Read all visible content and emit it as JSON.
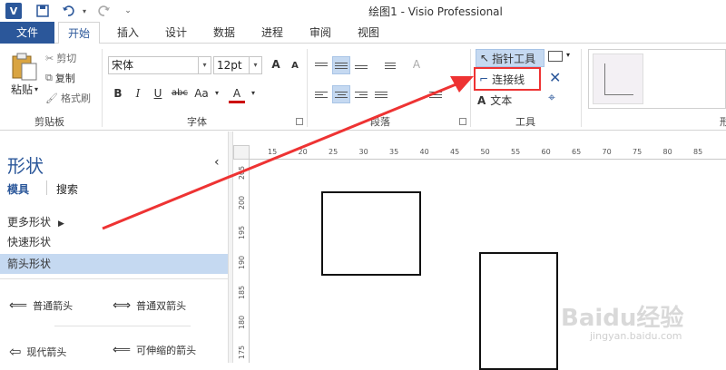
{
  "window": {
    "title": "绘图1 - Visio Professional"
  },
  "qat": {
    "app_icon": "V",
    "save_icon": "save-icon",
    "undo_icon": "undo-icon",
    "redo_icon": "redo-icon"
  },
  "tabs": [
    "文件",
    "开始",
    "插入",
    "设计",
    "数据",
    "进程",
    "审阅",
    "视图"
  ],
  "ribbon": {
    "clipboard": {
      "paste": "粘贴",
      "cut": "剪切",
      "copy": "复制",
      "format_painter": "格式刷",
      "label": "剪贴板"
    },
    "font": {
      "family": "宋体",
      "size": "12pt",
      "bold": "B",
      "italic": "I",
      "underline": "U",
      "strike": "abc",
      "case": "Aa",
      "color": "A",
      "grow": "A",
      "shrink": "A",
      "label": "字体"
    },
    "paragraph": {
      "label": "段落"
    },
    "tools": {
      "pointer": "指针工具",
      "connector": "连接线",
      "text": "文本",
      "label": "工具"
    },
    "styles": {
      "label": "形"
    }
  },
  "shapes": {
    "title": "形状",
    "tab_stencils": "模具",
    "tab_search": "搜索",
    "more_shapes": "更多形状",
    "quick_shapes": "快速形状",
    "arrow_shapes": "箭头形状",
    "masters": [
      "普通箭头",
      "普通双箭头",
      "现代箭头",
      "可伸缩的箭头"
    ]
  },
  "ruler": {
    "h": [
      "15",
      "20",
      "25",
      "30",
      "35",
      "40",
      "45",
      "50",
      "55",
      "60",
      "65",
      "70",
      "75",
      "80",
      "85"
    ],
    "v": [
      "205",
      "200",
      "195",
      "190",
      "185",
      "180",
      "175"
    ]
  },
  "watermark": {
    "brand": "Baidu经验",
    "url": "jingyan.baidu.com"
  },
  "colors": {
    "accent": "#2b579a",
    "highlight": "#e33",
    "selected": "#c5d9f1"
  }
}
